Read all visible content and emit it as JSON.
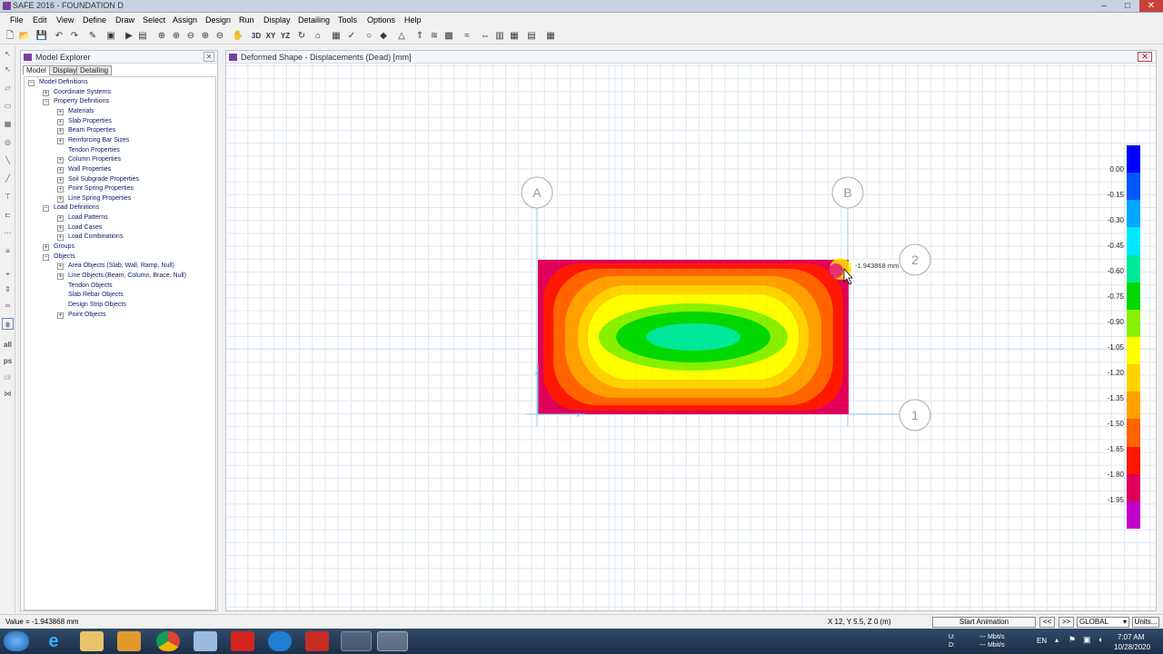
{
  "window": {
    "title": "SAFE 2016 - FOUNDATION D",
    "min": "–",
    "max": "□",
    "close": "✕"
  },
  "menu": [
    "File",
    "Edit",
    "View",
    "Define",
    "Draw",
    "Select",
    "Assign",
    "Design",
    "Run",
    "Display",
    "Detailing",
    "Tools",
    "Options",
    "Help"
  ],
  "toolbar_labels": {
    "3d": "3D",
    "xy": "XY",
    "yz": "YZ"
  },
  "left_tools": {
    "all": "all",
    "ps": "ps",
    "clr": "clr"
  },
  "explorer": {
    "title": "Model Explorer",
    "tabs": [
      "Model",
      "Display",
      "Detailing"
    ],
    "tree": [
      {
        "label": "Model Definitions",
        "level": 0,
        "toggle": "−"
      },
      {
        "label": "Coordinate Systems",
        "level": 1,
        "toggle": "+"
      },
      {
        "label": "Property Definitions",
        "level": 1,
        "toggle": "−"
      },
      {
        "label": "Materials",
        "level": 2,
        "toggle": "+"
      },
      {
        "label": "Slab Properties",
        "level": 2,
        "toggle": "+"
      },
      {
        "label": "Beam Properties",
        "level": 2,
        "toggle": "+"
      },
      {
        "label": "Reinforcing Bar Sizes",
        "level": 2,
        "toggle": "+"
      },
      {
        "label": "Tendon Properties",
        "level": 2,
        "toggle": ""
      },
      {
        "label": "Column Properties",
        "level": 2,
        "toggle": "+"
      },
      {
        "label": "Wall Properties",
        "level": 2,
        "toggle": "+"
      },
      {
        "label": "Soil Subgrade Properties",
        "level": 2,
        "toggle": "+"
      },
      {
        "label": "Point Spring Properties",
        "level": 2,
        "toggle": "+"
      },
      {
        "label": "Line Spring Properties",
        "level": 2,
        "toggle": "+"
      },
      {
        "label": "Load Definitions",
        "level": 1,
        "toggle": "−"
      },
      {
        "label": "Load Patterns",
        "level": 2,
        "toggle": "+"
      },
      {
        "label": "Load Cases",
        "level": 2,
        "toggle": "+"
      },
      {
        "label": "Load Combinations",
        "level": 2,
        "toggle": "+"
      },
      {
        "label": "Groups",
        "level": 1,
        "toggle": "+"
      },
      {
        "label": "Objects",
        "level": 1,
        "toggle": "−"
      },
      {
        "label": "Area Objects (Slab, Wall, Ramp, Null)",
        "level": 2,
        "toggle": "+"
      },
      {
        "label": "Line Objects (Beam, Column, Brace, Null)",
        "level": 2,
        "toggle": "+"
      },
      {
        "label": "Tendon Objects",
        "level": 2,
        "toggle": ""
      },
      {
        "label": "Slab Rebar Objects",
        "level": 2,
        "toggle": ""
      },
      {
        "label": "Design Strip Objects",
        "level": 2,
        "toggle": ""
      },
      {
        "label": "Point Objects",
        "level": 2,
        "toggle": "+"
      }
    ]
  },
  "view": {
    "title": "Deformed Shape - Displacements (Dead)  [mm]",
    "close": "✕",
    "grid_labels": {
      "a": "A",
      "b": "B",
      "two": "2",
      "one": "1"
    },
    "tooltip": "-1.943868 mm",
    "legend": {
      "values": [
        "0.00",
        "-0.15",
        "-0.30",
        "-0.45",
        "-0.60",
        "-0.75",
        "-0.90",
        "-1.05",
        "-1.20",
        "-1.35",
        "-1.50",
        "-1.65",
        "-1.80",
        "-1.95"
      ],
      "colors": [
        "#0000ff",
        "#0058ff",
        "#00a8ff",
        "#00e8ff",
        "#00e89a",
        "#00d800",
        "#88f000",
        "#ffff00",
        "#ffd200",
        "#ffa000",
        "#ff6400",
        "#ff1800",
        "#e0005a",
        "#c000c8"
      ]
    }
  },
  "status": {
    "value": "Value = -1.943868 mm",
    "coords": "X 12,  Y 5.5,  Z 0  (m)",
    "animation": "Start Animation",
    "prev": "<<",
    "next": ">>",
    "coord_system": "GLOBAL",
    "units": "Units..."
  },
  "taskbar": {
    "net_u_label": "U:",
    "net_d_label": "D:",
    "net_u": "--- Mbit/s",
    "net_d": "--- Mbit/s",
    "lang": "EN",
    "time": "7:07 AM",
    "date": "10/28/2020"
  }
}
